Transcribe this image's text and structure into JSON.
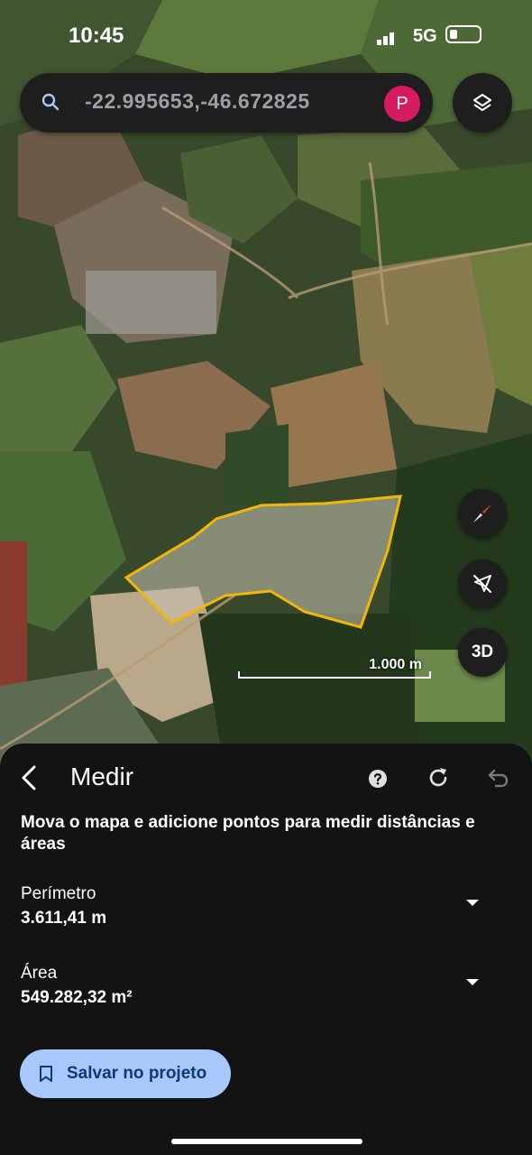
{
  "status_bar": {
    "time": "10:45",
    "network": "5G"
  },
  "search": {
    "query": "-22.995653,-46.672825",
    "avatar_initial": "P",
    "avatar_color": "#d81b60"
  },
  "map": {
    "scale_label": "1.000 m",
    "measure_outline_color": "#f2b705",
    "buttons": {
      "compass": "compass-icon",
      "location": "location-off-icon",
      "view3d": "3D",
      "layers": "layers-icon"
    }
  },
  "sheet": {
    "title": "Medir",
    "instruction": "Mova o mapa e adicione pontos para medir distâncias e áreas",
    "perimeter": {
      "label": "Perímetro",
      "value": "3.611,41 m"
    },
    "area": {
      "label": "Área",
      "value": "549.282,32 m²"
    },
    "save_label": "Salvar no projeto",
    "icons": {
      "back": "back-arrow-icon",
      "help": "help-icon",
      "refresh": "refresh-icon",
      "undo": "undo-icon"
    }
  },
  "colors": {
    "accent": "#a8c7fa",
    "sheet_bg": "#131314"
  }
}
